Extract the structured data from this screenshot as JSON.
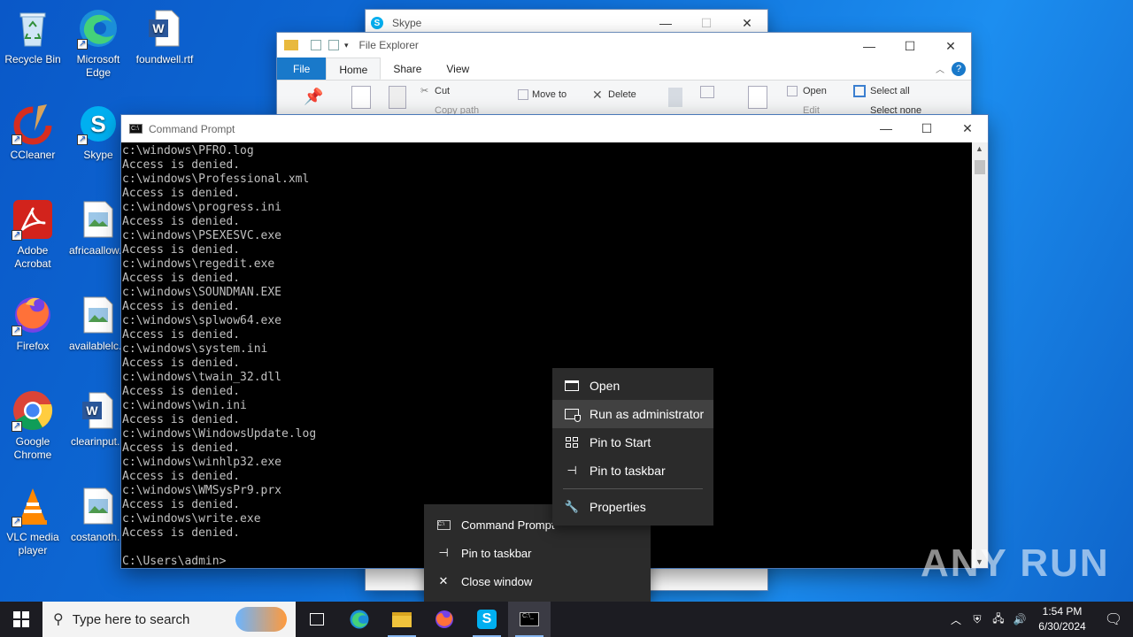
{
  "desktop": {
    "icons": [
      {
        "label": "Recycle Bin"
      },
      {
        "label": "Microsoft Edge"
      },
      {
        "label": "foundwell.rtf"
      },
      {
        "label": "CCleaner"
      },
      {
        "label": "Skype"
      },
      {
        "label": "Adobe Acrobat"
      },
      {
        "label": "africaallow..."
      },
      {
        "label": "Firefox"
      },
      {
        "label": "availablelc..."
      },
      {
        "label": "Google Chrome"
      },
      {
        "label": "clearinput..."
      },
      {
        "label": "VLC media player"
      },
      {
        "label": "costanoth..."
      }
    ]
  },
  "skype_window": {
    "title": "Skype"
  },
  "explorer_window": {
    "title": "File Explorer",
    "tabs": [
      "File",
      "Home",
      "Share",
      "View"
    ],
    "ribbon": {
      "cut": "Cut",
      "copy_path": "Copy path",
      "move_to": "Move to",
      "delete": "Delete",
      "open": "Open",
      "edit": "Edit",
      "select_all": "Select all",
      "select_none": "Select none"
    }
  },
  "cmd_window": {
    "title": "Command Prompt",
    "lines": [
      "c:\\windows\\PFRO.log",
      "Access is denied.",
      "c:\\windows\\Professional.xml",
      "Access is denied.",
      "c:\\windows\\progress.ini",
      "Access is denied.",
      "c:\\windows\\PSEXESVC.exe",
      "Access is denied.",
      "c:\\windows\\regedit.exe",
      "Access is denied.",
      "c:\\windows\\SOUNDMAN.EXE",
      "Access is denied.",
      "c:\\windows\\splwow64.exe",
      "Access is denied.",
      "c:\\windows\\system.ini",
      "Access is denied.",
      "c:\\windows\\twain_32.dll",
      "Access is denied.",
      "c:\\windows\\win.ini",
      "Access is denied.",
      "c:\\windows\\WindowsUpdate.log",
      "Access is denied.",
      "c:\\windows\\winhlp32.exe",
      "Access is denied.",
      "c:\\windows\\WMSysPr9.prx",
      "Access is denied.",
      "c:\\windows\\write.exe",
      "Access is denied.",
      "",
      "C:\\Users\\admin>"
    ]
  },
  "context_menu": {
    "items": [
      "Open",
      "Run as administrator",
      "Pin to Start",
      "Pin to taskbar",
      "Properties"
    ]
  },
  "jump_list": {
    "items": [
      "Command Prompt",
      "Pin to taskbar",
      "Close window"
    ]
  },
  "taskbar": {
    "search_placeholder": "Type here to search",
    "time": "1:54 PM",
    "date": "6/30/2024"
  },
  "watermark": "ANY RUN"
}
